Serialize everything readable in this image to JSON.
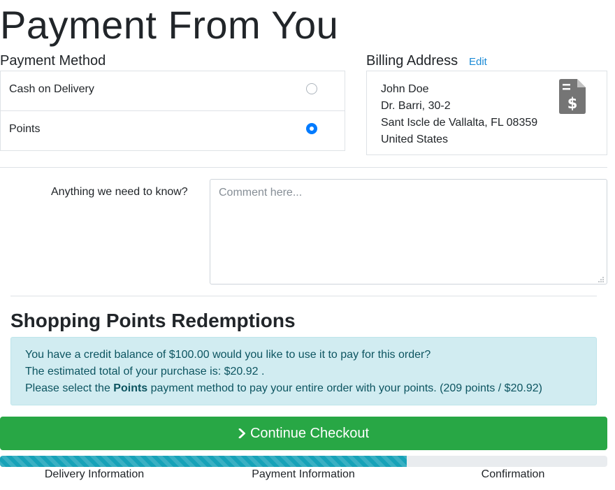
{
  "page": {
    "title": "Payment From You"
  },
  "payment_method": {
    "heading": "Payment Method",
    "options": [
      {
        "label": "Cash on Delivery",
        "selected": false
      },
      {
        "label": "Points",
        "selected": true
      }
    ]
  },
  "billing_address": {
    "heading": "Billing Address",
    "edit_label": "Edit",
    "lines": [
      "John Doe",
      "Dr. Barri, 30-2",
      "Sant Iscle de Vallalta, FL 08359",
      "United States"
    ],
    "icon": "file-invoice-dollar-icon"
  },
  "comment": {
    "label": "Anything we need to know?",
    "placeholder": "Comment here...",
    "value": ""
  },
  "points_redemption": {
    "heading": "Shopping Points Redemptions",
    "line1": "You have a credit balance of $100.00 would you like to use it to pay for this order?",
    "line2": "The estimated total of your purchase is: $20.92 .",
    "line3_prefix": "Please select the ",
    "line3_bold": "Points",
    "line3_suffix": " payment method to pay your entire order with your points. (209 points / $20.92)"
  },
  "actions": {
    "continue_label": "Continue Checkout"
  },
  "progress": {
    "percent": 67,
    "steps": [
      "Delivery Information",
      "Payment Information",
      "Confirmation"
    ]
  },
  "colors": {
    "accent_blue": "#007bff",
    "link_blue": "#1a8ad6",
    "success_green": "#28a745",
    "info_bg": "#d1ecf1",
    "info_text": "#0c5460",
    "progress_fill": "#17a2b8"
  }
}
